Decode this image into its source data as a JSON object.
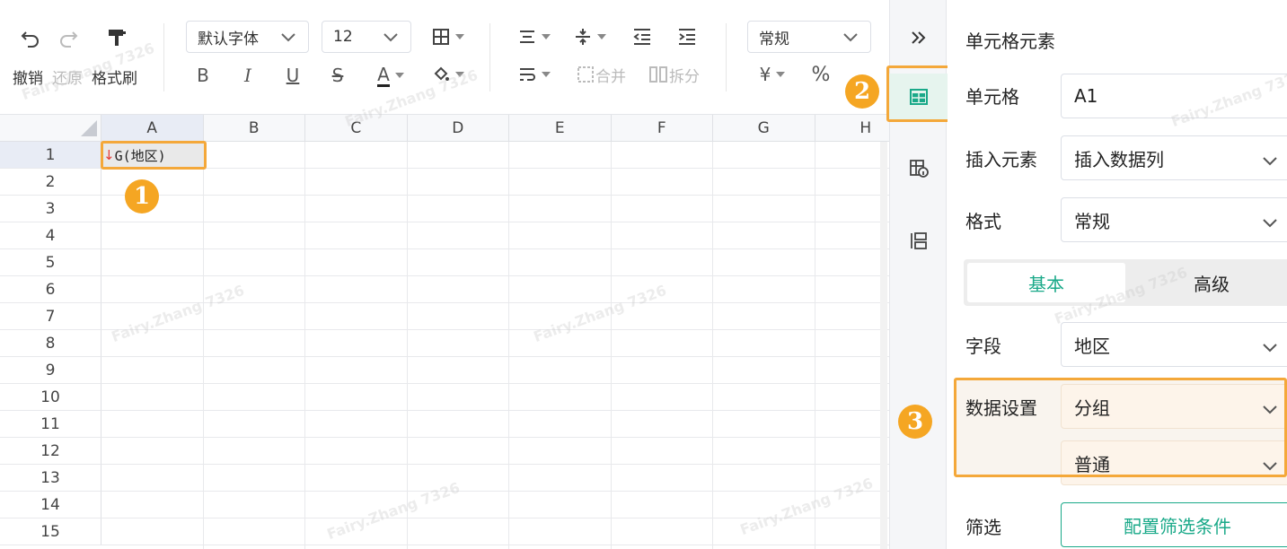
{
  "toolbar": {
    "undo_label": "撤销",
    "redo_label": "还原",
    "format_painter_label": "格式刷",
    "font_family": "默认字体",
    "font_size": "12",
    "bold": "B",
    "italic": "I",
    "underline": "U",
    "strike": "S",
    "font_color": "A",
    "merge_label": "合并",
    "split_label": "拆分",
    "number_format": "常规",
    "currency": "¥",
    "percent": "%"
  },
  "sheet": {
    "columns": [
      "A",
      "B",
      "C",
      "D",
      "E",
      "F",
      "G",
      "H"
    ],
    "rows": [
      "1",
      "2",
      "3",
      "4",
      "5",
      "6",
      "7",
      "8",
      "9",
      "10",
      "11",
      "12",
      "13",
      "14",
      "15"
    ],
    "cell_a1": "G(地区)",
    "cell_a1_arrow": "↓"
  },
  "annotations": {
    "badge1": "1",
    "badge2": "2",
    "badge3": "3"
  },
  "panel": {
    "title": "单元格元素",
    "cell_label": "单元格",
    "cell_value": "A1",
    "insert_label": "插入元素",
    "insert_value": "插入数据列",
    "format_label": "格式",
    "format_value": "常规",
    "tab_basic": "基本",
    "tab_advanced": "高级",
    "field_label": "字段",
    "field_value": "地区",
    "data_setting_label": "数据设置",
    "data_setting_value": "分组",
    "data_setting_sub_value": "普通",
    "filter_label": "筛选",
    "filter_button": "配置筛选条件"
  },
  "watermark": "Fairy.Zhang 7326",
  "colors": {
    "accent": "#1aa989",
    "highlight": "#f4a83a",
    "badge": "#f5a623"
  }
}
